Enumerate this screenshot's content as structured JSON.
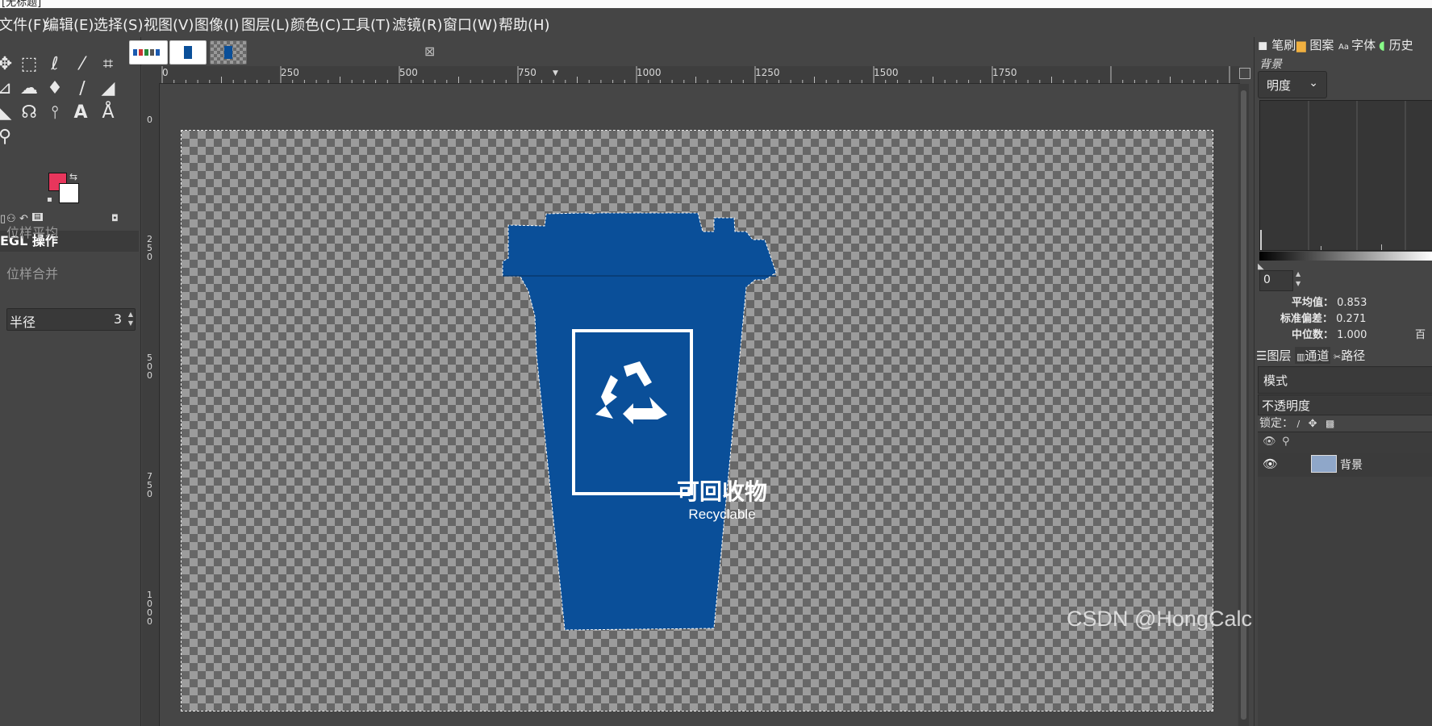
{
  "window": {
    "title_fragment": "[无标题]"
  },
  "menu": [
    "文件(F)",
    "编辑(E)",
    "选择(S)",
    "视图(V)",
    "图像(I)",
    "图层(L)",
    "颜色(C)",
    "工具(T)",
    "滤镜(R)",
    "窗口(W)",
    "帮助(H)"
  ],
  "toolbox": {
    "tools": [
      "move-tool",
      "rect-select-tool",
      "lasso-tool",
      "fuzzy-select-tool",
      "crop-tool",
      "transform-tool",
      "warp-tool",
      "bucket-fill-tool",
      "paintbrush-tool",
      "eraser-tool",
      "clone-tool",
      "smudge-tool",
      "paths-tool",
      "text-tool",
      "color-picker-tool",
      "zoom-tool"
    ],
    "foreground_color": "#e8365c",
    "background_color": "#ffffff",
    "options_title": "EGL 操作",
    "opt_sample_average": "位样平均",
    "radius_label": "半径",
    "radius_value": "3",
    "opt_sample_merged": "位样合并"
  },
  "ruler": {
    "h_labels": [
      "0",
      "250",
      "500",
      "750",
      "1000",
      "1250",
      "1500",
      "1750"
    ],
    "v_labels": [
      "0",
      "250",
      "500",
      "750",
      "1000"
    ]
  },
  "canvas": {
    "bin_color": "#0a4f99",
    "label_cn": "可回收物",
    "label_en": "Recyclable"
  },
  "right_dock": {
    "tabs": [
      "笔刷",
      "图案",
      "字体",
      "历史"
    ],
    "histogram_title": "背景",
    "channel": "明度",
    "range_start": "0",
    "stats": {
      "mean_label": "平均值：",
      "mean": "0.853",
      "std_label": "标准偏差：",
      "std": "0.271",
      "median_label": "中位数：",
      "median": "1.000",
      "percentile_label": "百"
    },
    "layer_tabs": [
      "图层",
      "通道",
      "路径"
    ],
    "mode_label": "模式",
    "opacity_label": "不透明度",
    "lock_label": "锁定：",
    "layer_name": "背景"
  },
  "watermark": "CSDN @HongCalc"
}
